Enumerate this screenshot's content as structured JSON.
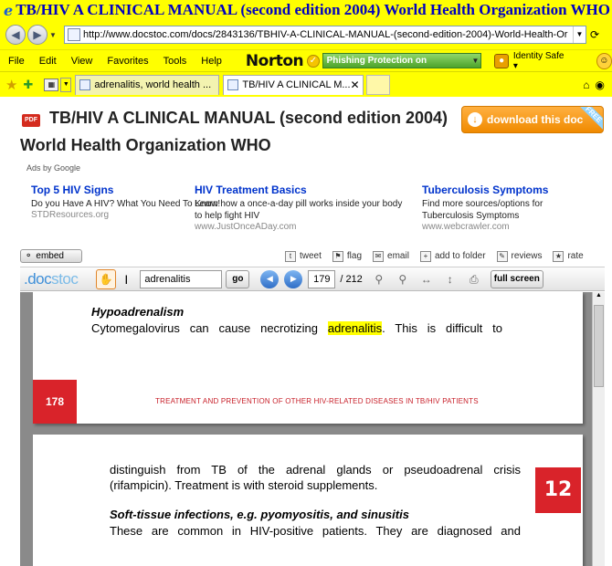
{
  "window": {
    "title": "TB/HIV A CLINICAL MANUAL (second edition 2004) World Health Organization WHO -"
  },
  "address_bar": {
    "url": "http://www.docstoc.com/docs/2843136/TBHIV-A-CLINICAL-MANUAL-(second-edition-2004)-World-Health-Or"
  },
  "menu": {
    "items": [
      "File",
      "Edit",
      "View",
      "Favorites",
      "Tools",
      "Help"
    ],
    "norton": "Norton",
    "phishing": "Phishing Protection on",
    "identity_safe": "Identity Safe ▾"
  },
  "tabs": [
    {
      "label": "adrenalitis, world health ...",
      "active": false
    },
    {
      "label": "TB/HIV A CLINICAL M...",
      "active": true
    }
  ],
  "page": {
    "pdf_badge": "PDF",
    "doc_title": "TB/HIV A CLINICAL MANUAL (second edition 2004) World Health Organization WHO",
    "download_label": "download this doc",
    "free_ribbon": "FREE",
    "ads_label": "Ads by Google",
    "ads": [
      {
        "title": "Top 5 HIV Signs",
        "body": "Do you Have A HIV? What You Need To Know!",
        "url": "STDResources.org"
      },
      {
        "title": "HIV Treatment Basics",
        "body": "Learn how a once-a-day pill works inside your body to help fight HIV",
        "url": "www.JustOnceADay.com"
      },
      {
        "title": "Tuberculosis Symptoms",
        "body": "Find more sources/options for Tuberculosis Symptoms",
        "url": "www.webcrawler.com"
      }
    ]
  },
  "actions": {
    "embed": "embed",
    "tweet": "tweet",
    "flag": "flag",
    "email": "email",
    "add_to_folder": "add to folder",
    "reviews": "reviews",
    "rate": "rate"
  },
  "viewer_toolbar": {
    "logo_doc": ".doc",
    "logo_stoc": "stoc",
    "search_value": "adrenalitis",
    "go": "go",
    "page_current": "179",
    "page_total": "/ 212",
    "full_screen": "full screen"
  },
  "document": {
    "sheet1": {
      "heading": "Hypoadrenalism",
      "line_before": "Cytomegalovirus can cause necrotizing ",
      "highlight": "adrenalitis",
      "line_after": ". This is difficult to",
      "page_number": "178",
      "running_head": "TREATMENT AND PREVENTION OF OTHER HIV-RELATED DISEASES IN TB/HIV PATIENTS"
    },
    "sheet2": {
      "para1_line1": "distinguish from TB of the adrenal glands or pseudoadrenal crisis",
      "para1_line2": "(rifampicin). Treatment is with steroid supplements.",
      "heading": "Soft-tissue infections, e.g. pyomyositis, and sinusitis",
      "para2_line1": "These are common in HIV-positive patients. They are diagnosed and",
      "chapter": "12"
    }
  }
}
